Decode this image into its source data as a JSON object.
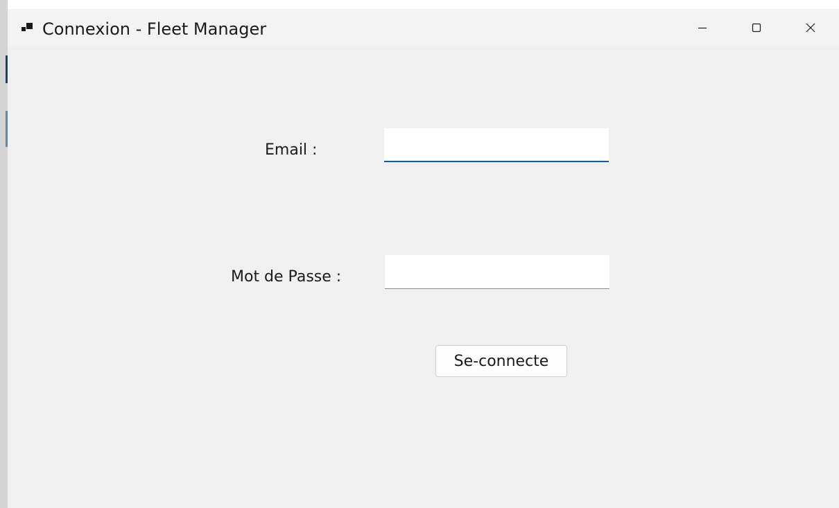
{
  "window": {
    "title": "Connexion - Fleet Manager",
    "app_icon": "app-window-icon",
    "controls": {
      "minimize_icon": "minimize-icon",
      "maximize_icon": "maximize-icon",
      "close_icon": "close-icon"
    }
  },
  "form": {
    "email_label": "Email :",
    "email_value": "",
    "password_label": "Mot de Passe :",
    "password_value": "",
    "submit_label": "Se-connecte"
  },
  "colors": {
    "focus_accent": "#005fb8",
    "window_background": "#f0f0f0",
    "titlebar_background": "#f3f3f3"
  }
}
